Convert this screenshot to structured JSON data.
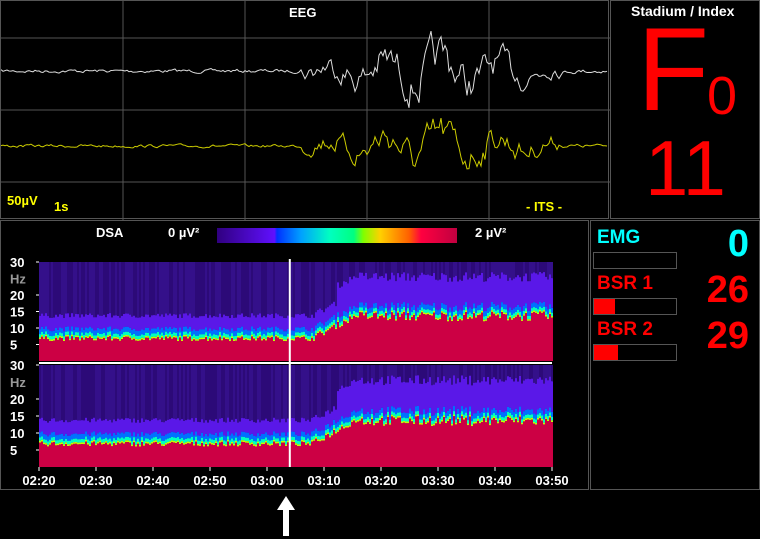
{
  "eeg": {
    "title": "EEG",
    "scale_label": "50µV",
    "time_label": "1s",
    "mode_label": "- ITS -"
  },
  "stadium": {
    "title": "Stadium / Index",
    "stage": "F",
    "stage_sub": "0",
    "index": "11"
  },
  "dsa": {
    "title": "DSA",
    "scale_min": "0 µV²",
    "scale_max": "2 µV²",
    "y_ticks": [
      "30",
      "Hz",
      "20",
      "15",
      "10",
      "5"
    ],
    "x_ticks": [
      "02:20",
      "02:30",
      "02:40",
      "02:50",
      "03:00",
      "03:10",
      "03:20",
      "03:30",
      "03:40",
      "03:50"
    ],
    "cursor_time": "03:04"
  },
  "params": [
    {
      "label": "EMG",
      "value": "0",
      "fill_percent": 0,
      "color": "#00ffff"
    },
    {
      "label": "BSR 1",
      "value": "26",
      "fill_percent": 26,
      "color": "#ff0000"
    },
    {
      "label": "BSR 2",
      "value": "29",
      "fill_percent": 29,
      "color": "#ff0000"
    }
  ],
  "colors": {
    "accent_red": "#ff0000",
    "emg_cyan": "#00ffff",
    "channel2_yellow": "#ffff00"
  }
}
